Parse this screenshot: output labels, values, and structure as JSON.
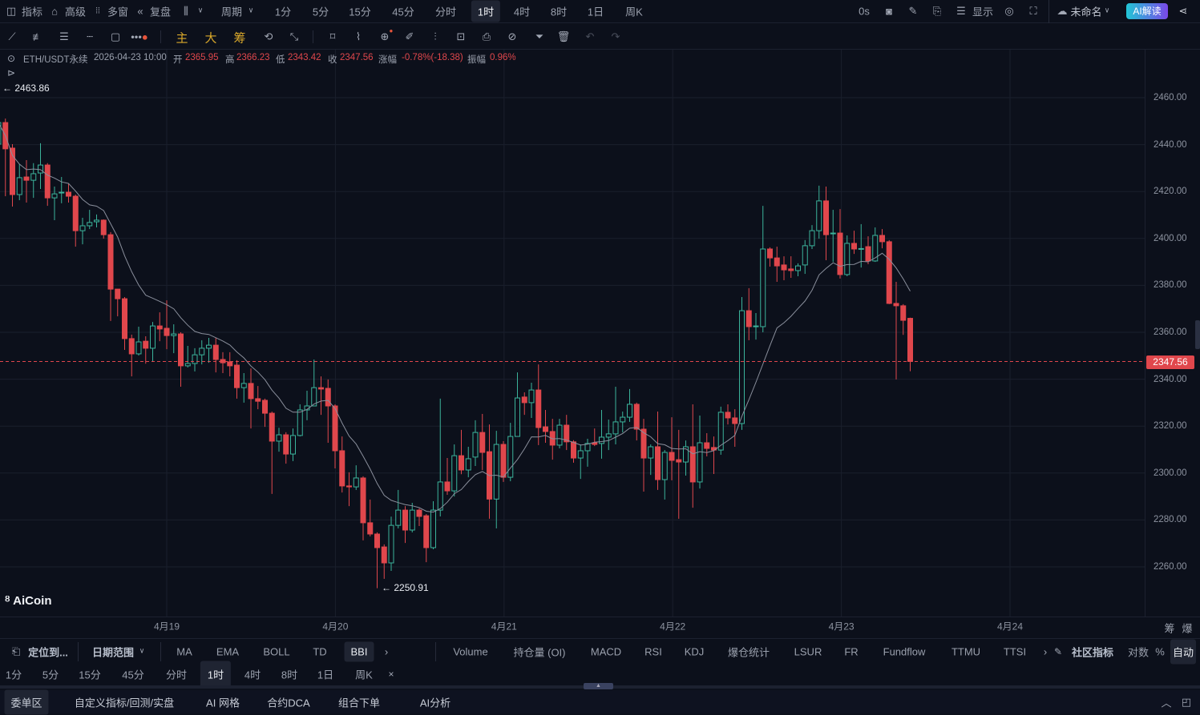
{
  "topbar": {
    "indicators": "指标",
    "advanced": "高级",
    "multi_window": "多窗",
    "replay": "复盘",
    "period": "周期",
    "periods": [
      "1分",
      "5分",
      "15分",
      "45分",
      "分时",
      "1时",
      "4时",
      "8时",
      "1日",
      "周K"
    ],
    "active_period": "1时",
    "countdown": "0s",
    "display": "显示",
    "layout_name": "未命名",
    "ai_button": "AI解读"
  },
  "toolbar": {
    "main": "主",
    "big": "大",
    "chips": "筹"
  },
  "info": {
    "symbol": "ETH/USDT永续",
    "datetime": "2026-04-23 10:00",
    "open_label": "开",
    "open": "2365.95",
    "high_label": "高",
    "high": "2366.23",
    "low_label": "低",
    "low": "2343.42",
    "close_label": "收",
    "close": "2347.56",
    "change_label": "涨幅",
    "change": "-0.78%(-18.38)",
    "amplitude_label": "振幅",
    "amplitude": "0.96%"
  },
  "logo": "AiCoin",
  "axis_right": {
    "chips": "筹",
    "liq": "爆"
  },
  "indicator_bar": {
    "locate": "定位到...",
    "date_range": "日期范围",
    "main_indicators": [
      "MA",
      "EMA",
      "BOLL",
      "TD",
      "BBI"
    ],
    "active_main": "BBI",
    "sub_indicators": [
      "Volume",
      "持仓量 (OI)",
      "MACD",
      "RSI",
      "KDJ",
      "爆仓统计",
      "LSUR",
      "FR",
      "Fundflow",
      "TTMU",
      "TTSI"
    ],
    "community": "社区指标",
    "log": "对数",
    "percent": "%",
    "auto": "自动"
  },
  "period_row": [
    "1分",
    "5分",
    "15分",
    "45分",
    "分时",
    "1时",
    "4时",
    "8时",
    "1日",
    "周K"
  ],
  "period_close": "×",
  "bottom_tabs": [
    "委单区",
    "自定义指标/回测/实盘",
    "AI 网格",
    "合约DCA",
    "组合下单",
    "AI分析"
  ],
  "colors": {
    "up": "#3bb39b",
    "down": "#e0474c",
    "bg": "#0c101b",
    "grid": "#1a1f2c",
    "ma": "#8a8f9c"
  },
  "chart_data": {
    "type": "candlestick",
    "title": "ETH/USDT永续 1时",
    "ylim": [
      2240,
      2480
    ],
    "y_ticks": [
      "2460.00",
      "2440.00",
      "2420.00",
      "2400.00",
      "2380.00",
      "2360.00",
      "2340.00",
      "2320.00",
      "2300.00",
      "2280.00",
      "2260.00"
    ],
    "x_ticks": [
      "4月19",
      "4月20",
      "4月21",
      "4月22",
      "4月23",
      "4月24"
    ],
    "current_price": "2347.56",
    "max_marker": "2463.86",
    "min_marker": "2250.91",
    "ohlc": [
      [
        2440.2,
        2450.4,
        2439.2,
        2449.4
      ],
      [
        2449.4,
        2451.1,
        2418.0,
        2438.2
      ],
      [
        2438.5,
        2440.2,
        2413.6,
        2418.7
      ],
      [
        2418.7,
        2431.7,
        2416.3,
        2425.9
      ],
      [
        2426.2,
        2433.4,
        2415.3,
        2424.8
      ],
      [
        2424.8,
        2432.1,
        2417.3,
        2427.6
      ],
      [
        2427.9,
        2440.6,
        2421.1,
        2431.3
      ],
      [
        2431.3,
        2432.1,
        2413.9,
        2417.3
      ],
      [
        2417.3,
        2422.1,
        2407.8,
        2419.0
      ],
      [
        2419.6,
        2426.2,
        2415.0,
        2419.7
      ],
      [
        2419.7,
        2423.5,
        2415.3,
        2418.0
      ],
      [
        2418.0,
        2418.7,
        2396.5,
        2403.3
      ],
      [
        2403.3,
        2408.8,
        2397.5,
        2405.4
      ],
      [
        2405.4,
        2412.2,
        2404.0,
        2406.8
      ],
      [
        2407.1,
        2410.2,
        2404.7,
        2407.8
      ],
      [
        2407.8,
        2408.1,
        2399.9,
        2401.6
      ],
      [
        2401.6,
        2402.7,
        2364.8,
        2378.4
      ],
      [
        2378.4,
        2377.7,
        2366.8,
        2374.3
      ],
      [
        2374.3,
        2375.0,
        2352.5,
        2357.3
      ],
      [
        2357.3,
        2359.0,
        2341.2,
        2350.8
      ],
      [
        2350.8,
        2362.4,
        2350.1,
        2355.9
      ],
      [
        2356.2,
        2358.3,
        2346.6,
        2353.2
      ],
      [
        2353.2,
        2364.4,
        2347.7,
        2362.7
      ],
      [
        2362.7,
        2368.5,
        2356.2,
        2361.4
      ],
      [
        2361.7,
        2373.6,
        2352.8,
        2358.6
      ],
      [
        2358.6,
        2363.4,
        2351.1,
        2359.3
      ],
      [
        2359.3,
        2360.0,
        2336.8,
        2345.7
      ],
      [
        2345.7,
        2354.2,
        2345.0,
        2346.7
      ],
      [
        2346.7,
        2353.2,
        2343.3,
        2350.4
      ],
      [
        2350.4,
        2356.6,
        2346.3,
        2353.2
      ],
      [
        2353.2,
        2357.6,
        2347.0,
        2354.5
      ],
      [
        2354.5,
        2357.6,
        2342.9,
        2348.4
      ],
      [
        2348.4,
        2351.5,
        2342.6,
        2347.0
      ],
      [
        2347.4,
        2351.5,
        2341.2,
        2345.7
      ],
      [
        2346.0,
        2348.1,
        2331.7,
        2336.4
      ],
      [
        2336.4,
        2342.6,
        2330.0,
        2338.2
      ],
      [
        2338.2,
        2344.6,
        2319.0,
        2331.7
      ],
      [
        2331.7,
        2337.1,
        2327.2,
        2330.6
      ],
      [
        2331.0,
        2331.7,
        2319.7,
        2325.5
      ],
      [
        2325.5,
        2326.2,
        2291.1,
        2313.6
      ],
      [
        2313.6,
        2319.3,
        2309.1,
        2316.3
      ],
      [
        2316.3,
        2317.4,
        2304.0,
        2308.1
      ],
      [
        2308.1,
        2319.0,
        2305.1,
        2316.0
      ],
      [
        2316.0,
        2329.3,
        2315.6,
        2326.9
      ],
      [
        2326.9,
        2335.1,
        2322.5,
        2328.6
      ],
      [
        2328.6,
        2348.4,
        2328.6,
        2336.4
      ],
      [
        2336.4,
        2341.2,
        2324.8,
        2335.8
      ],
      [
        2336.1,
        2339.9,
        2312.9,
        2328.6
      ],
      [
        2328.6,
        2329.3,
        2302.0,
        2309.5
      ],
      [
        2309.5,
        2315.6,
        2291.7,
        2294.5
      ],
      [
        2294.5,
        2300.3,
        2285.9,
        2294.1
      ],
      [
        2294.1,
        2303.3,
        2292.8,
        2297.9
      ],
      [
        2297.9,
        2298.6,
        2271.3,
        2278.8
      ],
      [
        2278.8,
        2288.7,
        2273.0,
        2274.0
      ],
      [
        2274.0,
        2274.7,
        2250.91,
        2268.2
      ],
      [
        2268.5,
        2269.6,
        2254.9,
        2261.7
      ],
      [
        2261.7,
        2281.4,
        2258.3,
        2277.7
      ],
      [
        2277.7,
        2292.8,
        2276.4,
        2284.2
      ],
      [
        2284.2,
        2285.9,
        2270.2,
        2275.7
      ],
      [
        2275.7,
        2287.3,
        2274.7,
        2284.2
      ],
      [
        2284.2,
        2284.9,
        2277.4,
        2281.5
      ],
      [
        2281.8,
        2282.5,
        2262.0,
        2268.2
      ],
      [
        2268.2,
        2288.0,
        2267.5,
        2284.2
      ],
      [
        2284.2,
        2331.7,
        2281.5,
        2296.2
      ],
      [
        2296.2,
        2306.4,
        2290.7,
        2292.4
      ],
      [
        2292.4,
        2312.2,
        2290.0,
        2307.4
      ],
      [
        2307.4,
        2318.4,
        2299.5,
        2301.3
      ],
      [
        2301.3,
        2311.2,
        2298.2,
        2306.1
      ],
      [
        2306.8,
        2322.5,
        2303.0,
        2317.3
      ],
      [
        2317.3,
        2325.2,
        2301.3,
        2308.8
      ],
      [
        2309.1,
        2320.7,
        2280.5,
        2288.9
      ],
      [
        2288.9,
        2318.0,
        2276.4,
        2312.2
      ],
      [
        2312.2,
        2313.6,
        2296.2,
        2298.2
      ],
      [
        2298.2,
        2321.4,
        2296.5,
        2315.6
      ],
      [
        2315.6,
        2342.9,
        2315.6,
        2332.0
      ],
      [
        2332.4,
        2334.4,
        2324.8,
        2330.0
      ],
      [
        2330.0,
        2338.5,
        2323.5,
        2335.4
      ],
      [
        2335.4,
        2346.3,
        2311.9,
        2319.4
      ],
      [
        2319.7,
        2326.9,
        2312.9,
        2317.7
      ],
      [
        2317.7,
        2323.1,
        2305.7,
        2311.9
      ],
      [
        2311.9,
        2323.1,
        2310.5,
        2320.4
      ],
      [
        2320.4,
        2324.8,
        2309.8,
        2313.3
      ],
      [
        2313.3,
        2314.0,
        2304.4,
        2306.4
      ],
      [
        2306.4,
        2312.2,
        2297.5,
        2309.5
      ],
      [
        2309.5,
        2314.6,
        2302.7,
        2312.6
      ],
      [
        2312.9,
        2319.0,
        2311.5,
        2312.2
      ],
      [
        2312.6,
        2326.9,
        2306.1,
        2315.3
      ],
      [
        2315.3,
        2322.8,
        2309.8,
        2316.7
      ],
      [
        2316.7,
        2336.8,
        2312.2,
        2321.8
      ],
      [
        2321.8,
        2326.2,
        2317.3,
        2323.8
      ],
      [
        2323.8,
        2335.8,
        2321.8,
        2329.3
      ],
      [
        2329.3,
        2330.0,
        2313.9,
        2318.7
      ],
      [
        2318.7,
        2323.1,
        2292.1,
        2306.4
      ],
      [
        2306.4,
        2312.2,
        2299.2,
        2311.2
      ],
      [
        2311.2,
        2326.2,
        2292.8,
        2297.2
      ],
      [
        2297.2,
        2309.8,
        2288.7,
        2308.8
      ],
      [
        2308.8,
        2323.8,
        2296.9,
        2305.4
      ],
      [
        2305.7,
        2318.4,
        2280.5,
        2304.7
      ],
      [
        2304.7,
        2313.9,
        2298.9,
        2311.2
      ],
      [
        2311.2,
        2329.3,
        2285.2,
        2296.2
      ],
      [
        2296.2,
        2324.5,
        2293.4,
        2312.9
      ],
      [
        2312.9,
        2317.0,
        2307.1,
        2310.5
      ],
      [
        2310.9,
        2315.6,
        2299.6,
        2309.8
      ],
      [
        2309.8,
        2328.3,
        2307.8,
        2325.9
      ],
      [
        2325.9,
        2329.3,
        2320.7,
        2323.5
      ],
      [
        2323.5,
        2327.2,
        2311.2,
        2321.1
      ],
      [
        2321.1,
        2375.0,
        2318.4,
        2369.2
      ],
      [
        2369.2,
        2378.8,
        2356.6,
        2362.4
      ],
      [
        2362.4,
        2368.2,
        2356.9,
        2362.7
      ],
      [
        2362.4,
        2413.9,
        2360.0,
        2395.5
      ],
      [
        2395.5,
        2396.2,
        2388.0,
        2391.7
      ],
      [
        2391.7,
        2396.5,
        2381.5,
        2388.3
      ],
      [
        2388.7,
        2392.4,
        2382.2,
        2386.6
      ],
      [
        2387.0,
        2392.4,
        2383.2,
        2386.3
      ],
      [
        2386.3,
        2389.4,
        2383.9,
        2388.3
      ],
      [
        2388.7,
        2399.3,
        2384.9,
        2396.9
      ],
      [
        2396.9,
        2405.7,
        2395.5,
        2403.3
      ],
      [
        2403.3,
        2422.5,
        2399.9,
        2416.0
      ],
      [
        2416.0,
        2422.1,
        2390.7,
        2401.6
      ],
      [
        2402.0,
        2412.2,
        2390.0,
        2402.3
      ],
      [
        2402.3,
        2412.5,
        2382.9,
        2384.6
      ],
      [
        2384.6,
        2401.3,
        2383.9,
        2397.9
      ],
      [
        2397.9,
        2403.3,
        2393.4,
        2395.5
      ],
      [
        2395.6,
        2406.1,
        2387.6,
        2395.7
      ],
      [
        2396.5,
        2400.9,
        2389.0,
        2390.4
      ],
      [
        2390.4,
        2404.7,
        2390.0,
        2401.3
      ],
      [
        2401.3,
        2404.0,
        2395.8,
        2398.6
      ],
      [
        2398.6,
        2399.3,
        2372.0,
        2372.3
      ],
      [
        2372.3,
        2381.5,
        2339.9,
        2371.3
      ],
      [
        2371.3,
        2372.0,
        2358.9,
        2365.1
      ],
      [
        2365.95,
        2366.23,
        2343.42,
        2347.56
      ]
    ]
  }
}
